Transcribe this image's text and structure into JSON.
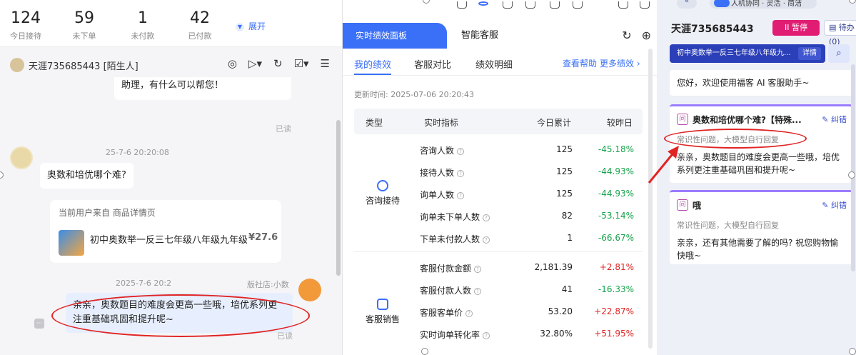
{
  "stats": [
    {
      "num": "124",
      "label": "今日接待"
    },
    {
      "num": "59",
      "label": "未下单"
    },
    {
      "num": "1",
      "label": "未付款"
    },
    {
      "num": "42",
      "label": "已付款"
    }
  ],
  "expand_label": "展开",
  "chat": {
    "contact_name": "天涯735685443 [陌生人]",
    "msg_truncated": "助理，有什么可以帮您！",
    "read_label": "已读",
    "customer_meta": "25-7-6 20:20:08",
    "customer_msg": "奥数和培优哪个难?",
    "product_source": "当前用户来自 商品详情页",
    "product_title": "初中奥数举一反三七年级八年级九年级...",
    "product_price": "¥27.6",
    "agent_meta_left": "2025-7-6 20:2",
    "agent_meta_right": "版社店:小数",
    "agent_msg": "亲亲，奥数题目的难度会更高一些哦，培优系列更注重基础巩固和提升呢~",
    "read_label_2": "已读"
  },
  "panel": {
    "tab_active": "实时绩效面板",
    "tab_other": "智能客服",
    "subtabs": [
      "我的绩效",
      "客服对比",
      "绩效明细"
    ],
    "help_link": "查看帮助",
    "more_link": "更多绩效 ›",
    "updated": "更新时间: 2025-07-06 20:20:43",
    "headers": [
      "类型",
      "实时指标",
      "今日累计",
      "较昨日"
    ],
    "groups": [
      {
        "label": "咨询接待",
        "rows": [
          {
            "name": "咨询人数",
            "value": "125",
            "cmp": "-45.18%",
            "dir": "down"
          },
          {
            "name": "接待人数",
            "value": "125",
            "cmp": "-44.93%",
            "dir": "down"
          },
          {
            "name": "询单人数",
            "value": "125",
            "cmp": "-44.93%",
            "dir": "down"
          },
          {
            "name": "询单未下单人数",
            "value": "82",
            "cmp": "-53.14%",
            "dir": "down"
          },
          {
            "name": "下单未付款人数",
            "value": "1",
            "cmp": "-66.67%",
            "dir": "down"
          }
        ]
      },
      {
        "label": "客服销售",
        "rows": [
          {
            "name": "客服付款金额",
            "value": "2,181.39",
            "cmp": "+2.81%",
            "dir": "up"
          },
          {
            "name": "客服付款人数",
            "value": "41",
            "cmp": "-16.33%",
            "dir": "down"
          },
          {
            "name": "客服客单价",
            "value": "53.20",
            "cmp": "+22.87%",
            "dir": "up"
          },
          {
            "name": "实时询单转化率",
            "value": "32.80%",
            "cmp": "+51.95%",
            "dir": "up"
          }
        ]
      }
    ]
  },
  "assistant": {
    "back": "«",
    "mode": "人机协同 · 灵活 · 简洁",
    "shop": "天涯735685443",
    "pause": "II 暂停",
    "pending": "待办 (0)",
    "product": "初中奥数举一反三七年级八年级九...",
    "detail": "详情",
    "welcome": "您好，欢迎使用福客 AI 客服助手~",
    "cards": [
      {
        "badge": "问",
        "question": "奥数和培优哪个难?【特殊...",
        "fix": "纠错",
        "type": "常识性问题，大模型自行回复",
        "answer": "亲亲，奥数题目的难度会更高一些哦，培优系列更注重基础巩固和提升呢~"
      },
      {
        "badge": "问",
        "question": "哦",
        "fix": "纠错",
        "type": "常识性问题，大模型自行回复",
        "answer": "亲亲，还有其他需要了解的吗? 祝您购物愉快哦~"
      }
    ]
  }
}
